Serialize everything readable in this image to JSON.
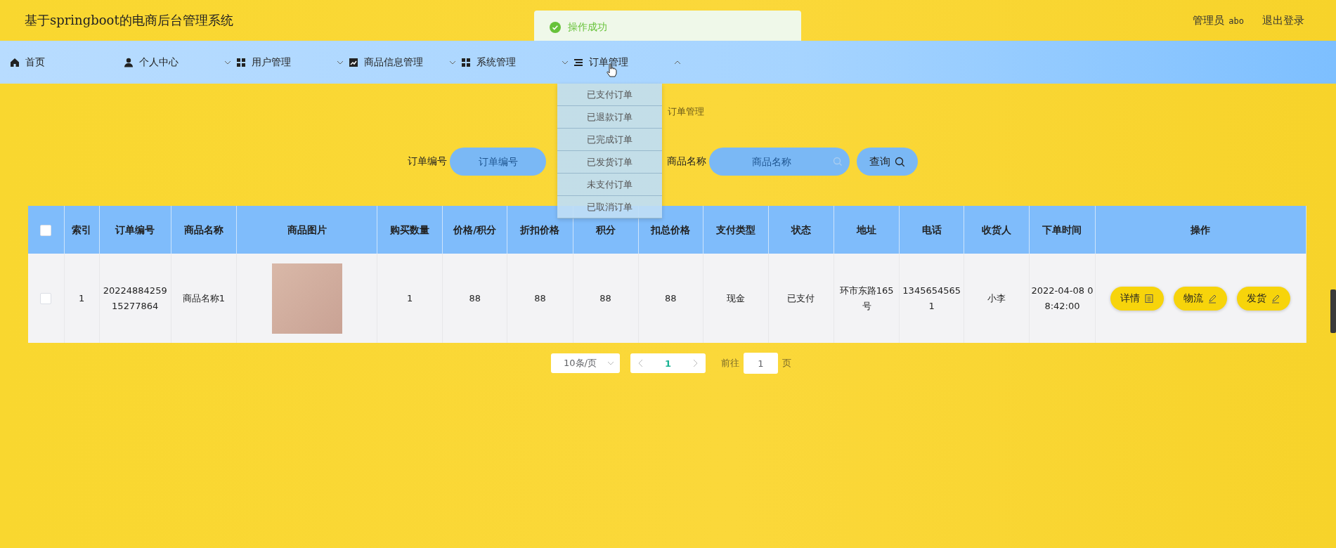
{
  "header": {
    "title": "基于springboot的电商后台管理系统",
    "user_role": "管理员",
    "user_name": "abo",
    "logout": "退出登录"
  },
  "toast": {
    "kind": "success",
    "message": "操作成功"
  },
  "nav": [
    {
      "label": "首页",
      "kind": "home"
    },
    {
      "label": "个人中心",
      "kind": "user",
      "expanded": false
    },
    {
      "label": "用户管理",
      "kind": "grid",
      "expanded": false
    },
    {
      "label": "商品信息管理",
      "kind": "chart",
      "expanded": false
    },
    {
      "label": "系统管理",
      "kind": "grid",
      "expanded": false
    },
    {
      "label": "订单管理",
      "kind": "list",
      "expanded": true,
      "children": [
        "已支付订单",
        "已退款订单",
        "已完成订单",
        "已发货订单",
        "未支付订单",
        "已取消订单"
      ]
    }
  ],
  "breadcrumb": [
    "订单管理"
  ],
  "search": [
    {
      "label": "订单编号",
      "placeholder": "订单编号"
    },
    {
      "label": "商品名称",
      "placeholder": "商品名称"
    }
  ],
  "search_button": "查询",
  "table": {
    "select_all_checked": false,
    "columns": [
      "索引",
      "订单编号",
      "商品名称",
      "商品图片",
      "购买数量",
      "价格/积分",
      "折扣价格",
      "积分",
      "扣总价格",
      "支付类型",
      "状态",
      "地址",
      "电话",
      "收货人",
      "下单时间",
      "操作"
    ],
    "rows": [
      {
        "checked": false,
        "cells": [
          "1",
          "20224884259 15277864",
          "商品名称1",
          "",
          "1",
          "88",
          "88",
          "88",
          "88",
          "现金",
          "已支付",
          "环市东路165号",
          "13456545651",
          "小李",
          "2022-04-08 08:42:00"
        ],
        "actions": [
          {
            "label": "详情",
            "kind": "view"
          },
          {
            "label": "物流",
            "kind": "edit"
          },
          {
            "label": "发货",
            "kind": "edit"
          }
        ]
      }
    ]
  },
  "pagination": {
    "page_size": "10条/页",
    "current_page": "1",
    "goto_label": "前往",
    "goto_value": "1",
    "page_suffix": "页"
  }
}
